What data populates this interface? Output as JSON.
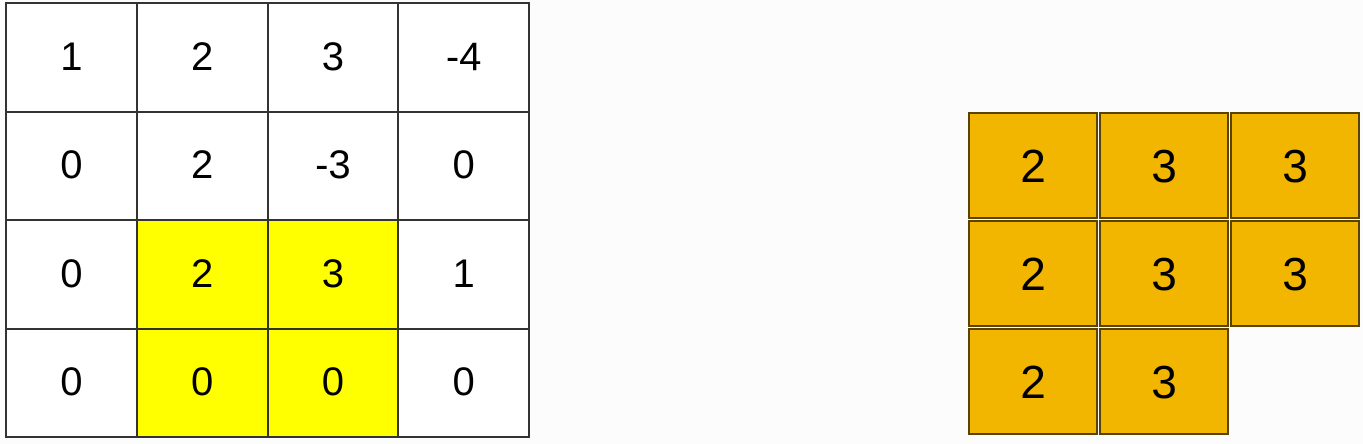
{
  "input_matrix": {
    "rows": [
      [
        "1",
        "2",
        "3",
        "-4"
      ],
      [
        "0",
        "2",
        "-3",
        "0"
      ],
      [
        "0",
        "2",
        "3",
        "1"
      ],
      [
        "0",
        "0",
        "0",
        "0"
      ]
    ],
    "highlight_color": "#ffff00"
  },
  "output_matrix": {
    "rows": [
      [
        "2",
        "3",
        "3"
      ],
      [
        "2",
        "3",
        "3"
      ],
      [
        "2",
        "3"
      ]
    ],
    "fill_color": "#f3b600"
  }
}
